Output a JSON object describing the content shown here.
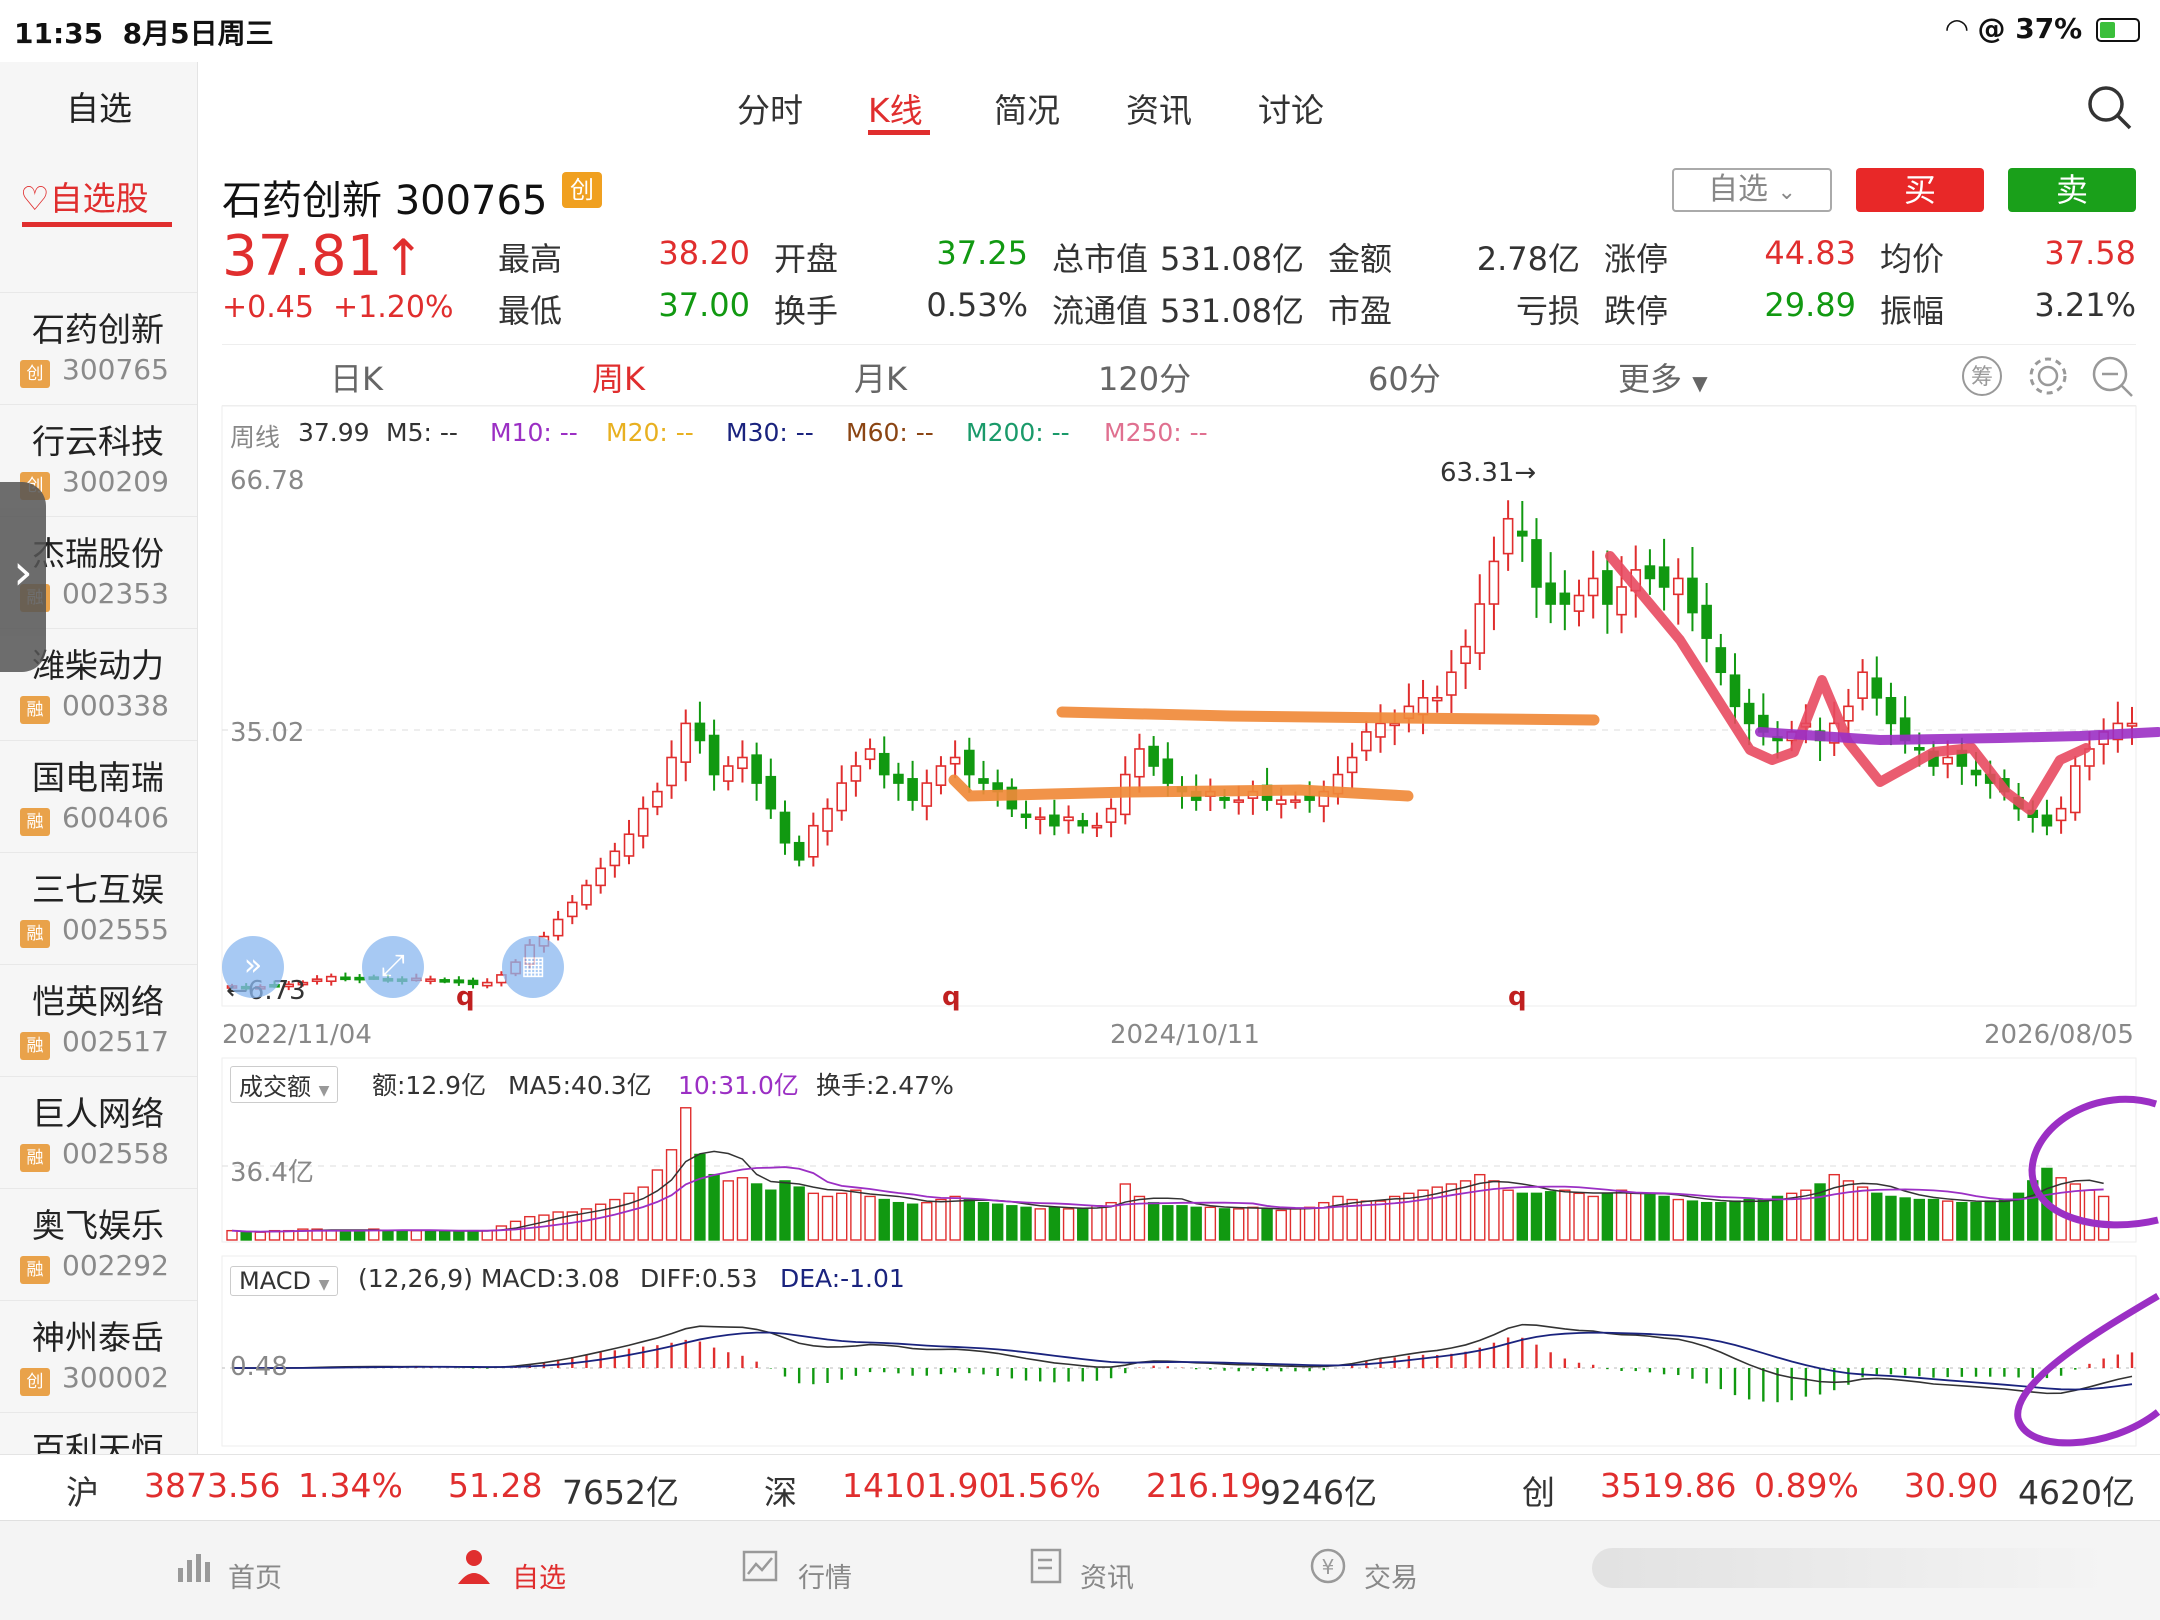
{
  "status": {
    "time": "11:35",
    "date": "8月5日周三",
    "battery": "37%"
  },
  "sidebar": {
    "title": "自选",
    "tab": "自选股",
    "items": [
      {
        "name": "石药创新",
        "badge": "创",
        "code": "300765"
      },
      {
        "name": "行云科技",
        "badge": "创",
        "code": "300209"
      },
      {
        "name": "杰瑞股份",
        "badge": "融",
        "code": "002353"
      },
      {
        "name": "潍柴动力",
        "badge": "融",
        "code": "000338"
      },
      {
        "name": "国电南瑞",
        "badge": "融",
        "code": "600406"
      },
      {
        "name": "三七互娱",
        "badge": "融",
        "code": "002555"
      },
      {
        "name": "恺英网络",
        "badge": "融",
        "code": "002517"
      },
      {
        "name": "巨人网络",
        "badge": "融",
        "code": "002558"
      },
      {
        "name": "奥飞娱乐",
        "badge": "融",
        "code": "002292"
      },
      {
        "name": "神州泰岳",
        "badge": "创",
        "code": "300002"
      },
      {
        "name": "百利天恒",
        "badge": "",
        "code": ""
      }
    ]
  },
  "nav": {
    "tabs": [
      "分时",
      "K线",
      "简况",
      "资讯",
      "讨论"
    ],
    "active": 1
  },
  "stock": {
    "name": "石药创新 300765",
    "board": "创",
    "price": "37.81",
    "arrow": "↑",
    "change": "+0.45",
    "change_pct": "+1.20%",
    "fav_label": "自选",
    "buy_label": "买",
    "sell_label": "卖",
    "quote": [
      {
        "k": "最高",
        "v": "38.20",
        "c": "red"
      },
      {
        "k": "开盘",
        "v": "37.25",
        "c": "green"
      },
      {
        "k": "总市值",
        "v": "531.08亿",
        "c": "dark"
      },
      {
        "k": "金额",
        "v": "2.78亿",
        "c": "dark"
      },
      {
        "k": "涨停",
        "v": "44.83",
        "c": "red"
      },
      {
        "k": "均价",
        "v": "37.58",
        "c": "red"
      },
      {
        "k": "最低",
        "v": "37.00",
        "c": "green"
      },
      {
        "k": "换手",
        "v": "0.53%",
        "c": "dark"
      },
      {
        "k": "流通值",
        "v": "531.08亿",
        "c": "dark"
      },
      {
        "k": "市盈",
        "v": "亏损",
        "c": "dark"
      },
      {
        "k": "跌停",
        "v": "29.89",
        "c": "green"
      },
      {
        "k": "振幅",
        "v": "3.21%",
        "c": "dark"
      }
    ]
  },
  "periods": {
    "tabs": [
      "日K",
      "周K",
      "月K",
      "120分",
      "60分",
      "更多"
    ],
    "active": 1
  },
  "ma_legend": {
    "prefix": "周线",
    "close": "37.99",
    "items": [
      {
        "label": "M5: --",
        "color": "#333333"
      },
      {
        "label": "M10: --",
        "color": "#9b2fc4"
      },
      {
        "label": "M20: --",
        "color": "#e8b020"
      },
      {
        "label": "M30: --",
        "color": "#1a237e"
      },
      {
        "label": "M60: --",
        "color": "#8b4513"
      },
      {
        "label": "M200: --",
        "color": "#1a9a6a"
      },
      {
        "label": "M250: --",
        "color": "#e07090"
      }
    ]
  },
  "chart_labels": {
    "y_top": "66.78",
    "y_mid": "35.02",
    "y_min_marker": "←6.73",
    "y_max_marker": "63.31→",
    "x_start": "2022/11/04",
    "x_mid": "2024/10/11",
    "x_end": "2026/08/05",
    "q_marks": [
      "q",
      "q",
      "q"
    ]
  },
  "volume": {
    "selector": "成交额",
    "amount": "额:12.9亿",
    "ma5": "MA5:40.3亿",
    "ma10": "10:31.0亿",
    "turnover": "换手:2.47%",
    "axis": "36.4亿"
  },
  "macd": {
    "selector": "MACD",
    "params": "(12,26,9) MACD:3.08",
    "diff": "DIFF:0.53",
    "dea": "DEA:-1.01",
    "axis": "0.48"
  },
  "index_bar": [
    {
      "name": "沪",
      "value": "3873.56",
      "pct": "1.34%",
      "chg": "51.28",
      "amount": "7652亿"
    },
    {
      "name": "深",
      "value": "14101.90",
      "pct": "1.56%",
      "chg": "216.19",
      "amount": "9246亿"
    },
    {
      "name": "创",
      "value": "3519.86",
      "pct": "0.89%",
      "chg": "30.90",
      "amount": "4620亿"
    }
  ],
  "bottom_nav": {
    "items": [
      "首页",
      "自选",
      "行情",
      "资讯",
      "交易"
    ],
    "active": 1
  },
  "chart_data": {
    "type": "candlestick",
    "title": "石药创新 300765 周K",
    "period": "weekly",
    "x_range": [
      "2022/11/04",
      "2026/08/05"
    ],
    "ylim": [
      6.73,
      66.78
    ],
    "max_price": 63.31,
    "min_price": 6.73,
    "close_series": [
      7.2,
      7.0,
      7.1,
      7.3,
      7.4,
      7.6,
      8.0,
      8.3,
      8.1,
      8.0,
      8.2,
      8.0,
      7.9,
      8.1,
      8.0,
      7.8,
      7.6,
      7.4,
      7.6,
      8.5,
      10,
      12,
      13,
      15,
      17,
      19,
      21,
      23,
      25,
      28,
      30,
      34,
      38,
      36,
      32,
      33,
      34,
      31,
      28,
      24,
      22,
      26,
      28,
      31,
      33,
      35,
      32,
      31,
      29,
      31,
      33,
      34,
      32,
      31,
      30,
      28,
      27,
      27,
      26,
      27,
      26,
      26,
      28,
      32,
      35,
      33,
      31,
      30,
      29,
      30,
      29,
      29,
      30,
      29,
      29,
      29,
      29,
      30,
      32,
      34,
      37,
      38,
      38,
      40,
      41,
      41,
      44,
      47,
      52,
      57,
      62,
      60,
      54,
      52,
      52,
      53,
      55,
      52,
      54,
      56,
      55,
      54,
      55,
      51,
      48,
      44,
      40,
      38,
      37,
      36,
      37,
      38,
      36,
      38,
      40,
      44,
      41,
      38,
      36,
      35,
      33,
      34,
      33,
      32,
      31,
      30,
      28,
      27,
      26,
      28,
      33,
      35,
      37,
      38,
      37.99
    ],
    "volume_series": [
      0.6,
      0.5,
      0.5,
      0.6,
      0.6,
      0.7,
      0.7,
      0.6,
      0.6,
      0.6,
      0.7,
      0.6,
      0.6,
      0.6,
      0.6,
      0.6,
      0.5,
      0.6,
      0.6,
      0.9,
      1.2,
      1.5,
      1.6,
      1.8,
      1.8,
      2.0,
      2.3,
      2.6,
      3.0,
      3.4,
      4.5,
      5.8,
      8.5,
      5.5,
      4.2,
      3.8,
      4.0,
      3.6,
      3.2,
      3.8,
      3.4,
      3.0,
      2.8,
      3.0,
      3.2,
      2.8,
      2.6,
      2.4,
      2.3,
      2.4,
      2.6,
      2.8,
      2.6,
      2.4,
      2.3,
      2.2,
      2.1,
      2.0,
      2.1,
      2.0,
      2.0,
      2.2,
      2.4,
      3.6,
      2.8,
      2.4,
      2.2,
      2.2,
      2.1,
      2.1,
      2.0,
      2.0,
      2.1,
      2.0,
      1.9,
      2.0,
      2.1,
      2.4,
      2.8,
      2.6,
      2.5,
      2.5,
      2.8,
      3.0,
      3.2,
      3.4,
      3.6,
      3.8,
      4.2,
      3.8,
      3.2,
      3.0,
      3.0,
      3.1,
      3.2,
      3.0,
      2.8,
      3.0,
      3.2,
      3.0,
      2.9,
      2.8,
      2.6,
      2.5,
      2.4,
      2.4,
      2.5,
      2.6,
      2.6,
      2.8,
      3.0,
      3.2,
      3.6,
      4.2,
      3.8,
      3.4,
      3.0,
      2.8,
      2.7,
      2.6,
      2.6,
      2.5,
      2.4,
      2.4,
      2.5,
      2.6,
      3.0,
      3.8,
      4.6,
      4.0,
      3.6,
      3.2,
      2.8
    ],
    "volume_axis_label": "36.4亿",
    "macd_axis_label": "0.48"
  }
}
